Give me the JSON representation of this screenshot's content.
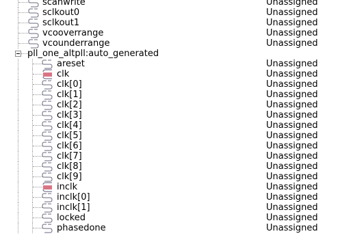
{
  "status_label": "Unassigned",
  "top_items": [
    {
      "name": "scanwrite",
      "status": "Unassigned",
      "icon": "input-pin-icon"
    },
    {
      "name": "sclkout0",
      "status": "Unassigned",
      "icon": "input-pin-icon"
    },
    {
      "name": "sclkout1",
      "status": "Unassigned",
      "icon": "input-pin-icon"
    },
    {
      "name": "vcooverrange",
      "status": "Unassigned",
      "icon": "input-pin-icon"
    },
    {
      "name": "vcounderrange",
      "status": "Unassigned",
      "icon": "input-pin-icon"
    }
  ],
  "group": {
    "name": "pll_one_altpll:auto_generated",
    "expander_icon": "collapse-minus-icon",
    "items": [
      {
        "name": "areset",
        "status": "Unassigned",
        "icon": "input-pin-icon"
      },
      {
        "name": "clk",
        "status": "Unassigned",
        "icon": "bus-pin-icon"
      },
      {
        "name": "clk[0]",
        "status": "Unassigned",
        "icon": "input-pin-icon"
      },
      {
        "name": "clk[1]",
        "status": "Unassigned",
        "icon": "input-pin-icon"
      },
      {
        "name": "clk[2]",
        "status": "Unassigned",
        "icon": "input-pin-icon"
      },
      {
        "name": "clk[3]",
        "status": "Unassigned",
        "icon": "input-pin-icon"
      },
      {
        "name": "clk[4]",
        "status": "Unassigned",
        "icon": "input-pin-icon"
      },
      {
        "name": "clk[5]",
        "status": "Unassigned",
        "icon": "input-pin-icon"
      },
      {
        "name": "clk[6]",
        "status": "Unassigned",
        "icon": "input-pin-icon"
      },
      {
        "name": "clk[7]",
        "status": "Unassigned",
        "icon": "input-pin-icon"
      },
      {
        "name": "clk[8]",
        "status": "Unassigned",
        "icon": "input-pin-icon"
      },
      {
        "name": "clk[9]",
        "status": "Unassigned",
        "icon": "input-pin-icon"
      },
      {
        "name": "inclk",
        "status": "Unassigned",
        "icon": "bus-pin-icon"
      },
      {
        "name": "inclk[0]",
        "status": "Unassigned",
        "icon": "input-pin-icon"
      },
      {
        "name": "inclk[1]",
        "status": "Unassigned",
        "icon": "input-pin-icon"
      },
      {
        "name": "locked",
        "status": "Unassigned",
        "icon": "input-pin-icon"
      },
      {
        "name": "phasedone",
        "status": "Unassigned",
        "icon": "input-pin-icon"
      }
    ]
  }
}
